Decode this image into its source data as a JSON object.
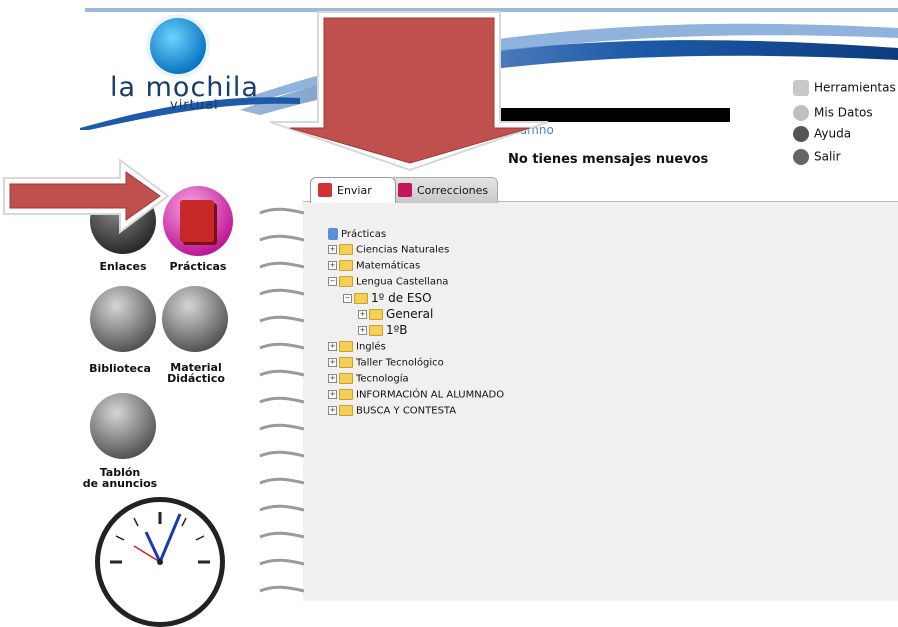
{
  "brand": {
    "name": "la mochila",
    "subtitle": "virtual"
  },
  "user": {
    "name": "Alumno",
    "messages": "No tienes mensajes nuevos"
  },
  "utility_menu": [
    {
      "label": "Herramientas",
      "icon": "tools-icon"
    },
    {
      "label": "Mis Datos",
      "icon": "user-icon"
    },
    {
      "label": "Ayuda",
      "icon": "help-icon"
    },
    {
      "label": "Salir",
      "icon": "exit-icon"
    }
  ],
  "nav": [
    {
      "label": "Enlaces",
      "icon": "link-icon"
    },
    {
      "label": "Prácticas",
      "icon": "book-icon"
    },
    {
      "label": "Biblioteca",
      "icon": "library-icon"
    },
    {
      "label": "Material Didáctico",
      "label_line1": "Material",
      "label_line2": "Didáctico",
      "icon": "drawing-tools-icon"
    },
    {
      "label": "Tablón de anuncios",
      "label_line1": "Tablón",
      "label_line2": "de anuncios",
      "icon": "notice-board-icon"
    }
  ],
  "tabs": [
    {
      "label": "Enviar",
      "active": true
    },
    {
      "label": "Correcciones",
      "active": false
    }
  ],
  "tree": {
    "root": "Prácticas",
    "items": [
      "Ciencias Naturales",
      "Matemáticas",
      "Lengua Castellana",
      "1º de ESO",
      "General",
      "1ºB",
      "Inglés",
      "Taller Tecnológico",
      "Tecnología",
      "INFORMACIÓN AL ALUMNADO",
      "BUSCA Y CONTESTA"
    ]
  },
  "colors": {
    "brand": "#173c6d",
    "accent_blue": "#2b74c9",
    "annotation_red": "#c0504d",
    "panel": "#f0f0f0",
    "practicas_magenta": "#c21f9b"
  }
}
